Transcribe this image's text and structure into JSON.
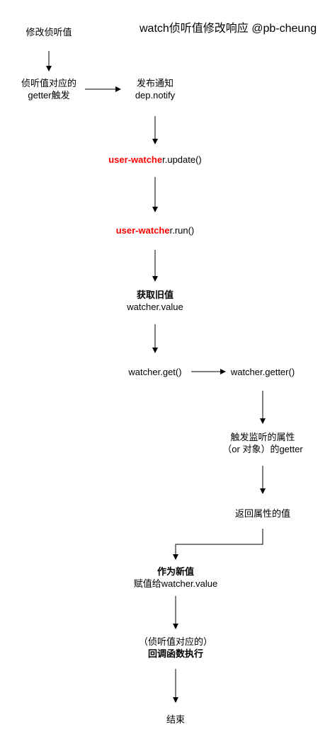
{
  "title": {
    "line1": "watch侦听值修改响应",
    "line2": "@pb-cheung"
  },
  "nodes": {
    "modify": "修改侦听值",
    "getter_trigger": {
      "line1": "侦听值对应的",
      "line2": "getter触发"
    },
    "notify": {
      "line1": "发布通知",
      "line2": "dep.notify"
    },
    "update": {
      "highlight": "user-watche",
      "rest": "r.update()"
    },
    "run": {
      "highlight": "user-watche",
      "rest": "r.run()"
    },
    "old_value": {
      "line1": "获取旧值",
      "line2": "watcher.value"
    },
    "get": "watcher.get()",
    "getter": "watcher.getter()",
    "trigger_monitor": {
      "line1": "触发监听的属性",
      "line2": "（or 对象）的getter"
    },
    "return_value": "返回属性的值",
    "new_value": {
      "line1": "作为新值",
      "line2": "赋值给watcher.value"
    },
    "callback": {
      "line1": "（侦听值对应的）",
      "line2": "回调函数执行"
    },
    "end": "结束"
  },
  "colors": {
    "highlight": "#ff0000",
    "text": "#000000",
    "arrow": "#000000"
  }
}
